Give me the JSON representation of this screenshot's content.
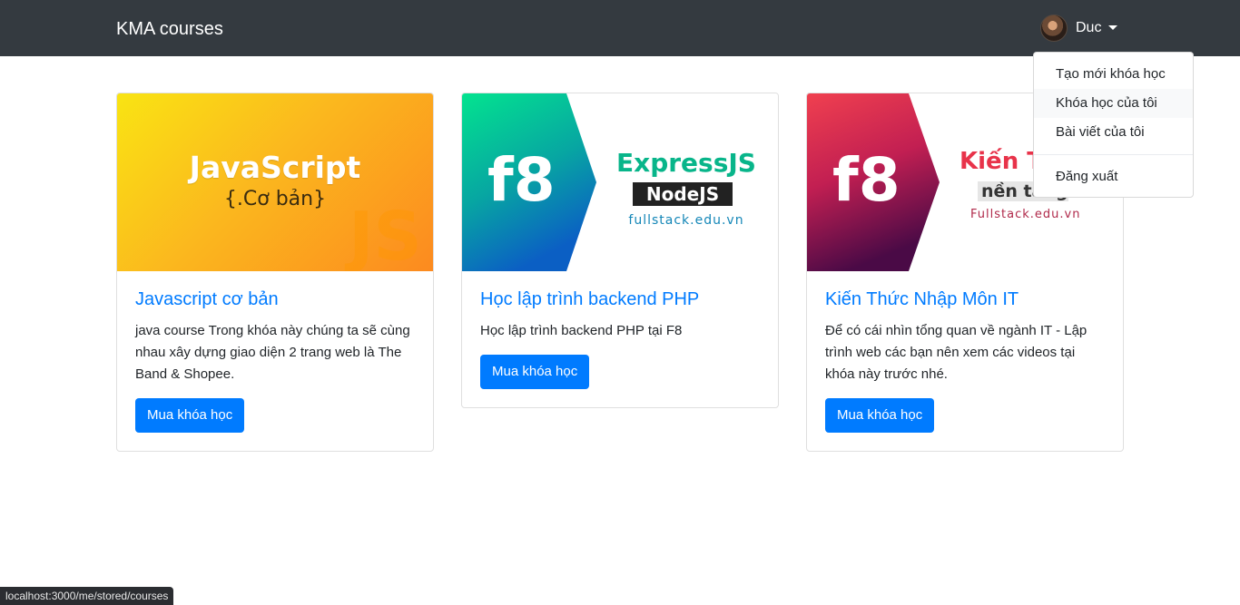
{
  "navbar": {
    "brand": "KMA courses",
    "user_name": "Duc"
  },
  "dropdown": {
    "items": [
      "Tạo mới khóa học",
      "Khóa học của tôi",
      "Bài viết của tôi"
    ],
    "logout": "Đăng xuất"
  },
  "courses": [
    {
      "title": "Javascript cơ bản",
      "description": "java course Trong khóa này chúng ta sẽ cùng nhau xây dựng giao diện 2 trang web là The Band & Shopee.",
      "button": "Mua khóa học",
      "thumb": {
        "main": "JavaScript",
        "sub": "{.Cơ bản}",
        "bg": "JS"
      }
    },
    {
      "title": "Học lập trình backend PHP",
      "description": "Học lập trình backend PHP tại F8",
      "button": "Mua khóa học",
      "thumb": {
        "logo": "f8",
        "line1": "ExpressJS",
        "line2": "NodeJS",
        "domain": "fullstack.edu.vn"
      }
    },
    {
      "title": "Kiến Thức Nhập Môn IT",
      "description": "Để có cái nhìn tổng quan về ngành IT - Lập trình web các bạn nên xem các videos tại khóa này trước nhé.",
      "button": "Mua khóa học",
      "thumb": {
        "logo": "f8",
        "line1": "Kiến T",
        "line2": "nền tảng",
        "domain": "Fullstack.edu.vn"
      }
    }
  ],
  "status_bar": "localhost:3000/me/stored/courses",
  "colors": {
    "navbar": "#343a40",
    "primary": "#007bff"
  }
}
